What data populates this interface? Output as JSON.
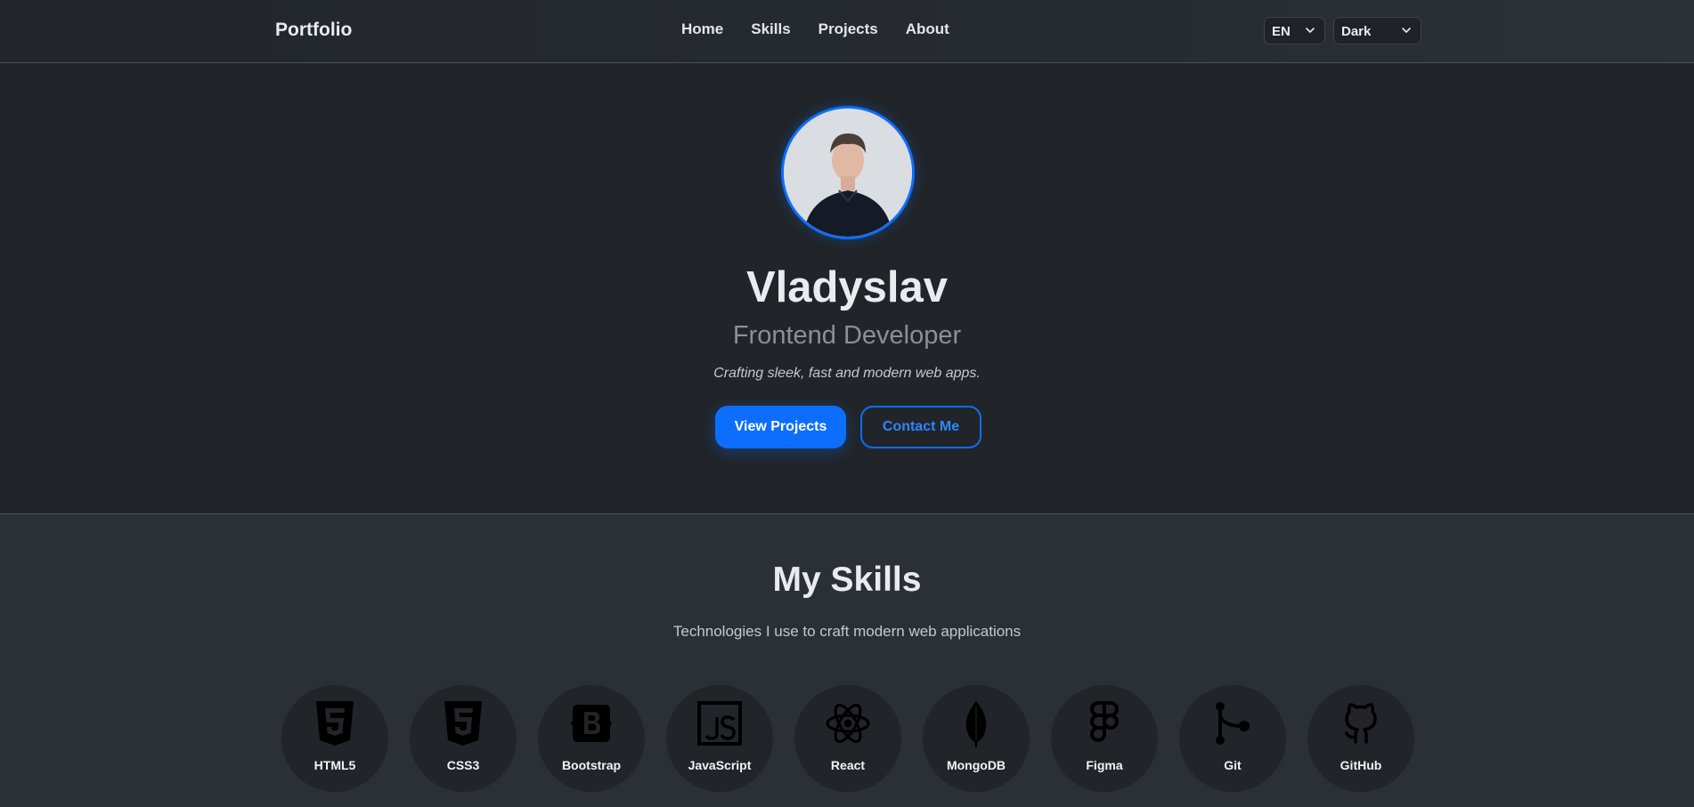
{
  "navbar": {
    "brand": "Portfolio",
    "links": [
      "Home",
      "Skills",
      "Projects",
      "About"
    ],
    "language": "EN",
    "theme": "Dark"
  },
  "hero": {
    "name": "Vladyslav",
    "role": "Frontend Developer",
    "tagline": "Crafting sleek, fast and modern web apps.",
    "primary_button": "View Projects",
    "secondary_button": "Contact Me"
  },
  "skills": {
    "title": "My Skills",
    "subtitle": "Technologies I use to craft modern web applications",
    "items": [
      {
        "label": "HTML5",
        "icon": "html5-icon"
      },
      {
        "label": "CSS3",
        "icon": "css3-icon"
      },
      {
        "label": "Bootstrap",
        "icon": "bootstrap-icon"
      },
      {
        "label": "JavaScript",
        "icon": "javascript-icon"
      },
      {
        "label": "React",
        "icon": "react-icon"
      },
      {
        "label": "MongoDB",
        "icon": "mongodb-icon"
      },
      {
        "label": "Figma",
        "icon": "figma-icon"
      },
      {
        "label": "Git",
        "icon": "git-icon"
      },
      {
        "label": "GitHub",
        "icon": "github-icon"
      }
    ]
  },
  "colors": {
    "accent": "#0d6efd",
    "background": "#212529",
    "section_background": "#2b3035"
  }
}
